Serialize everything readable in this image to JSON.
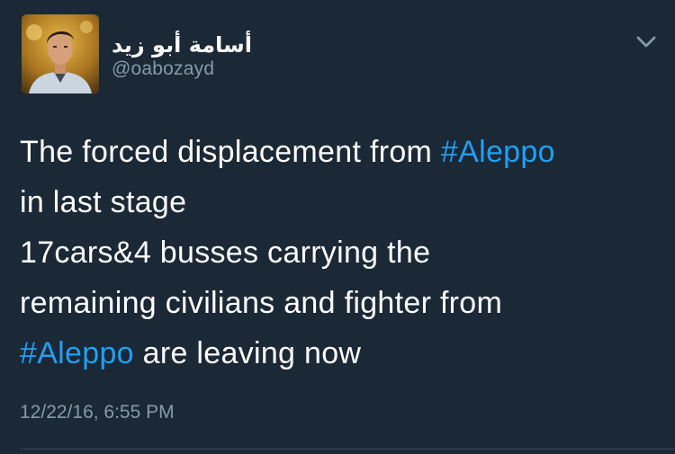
{
  "author": {
    "name": "أسامة أبو زيد",
    "handle": "@oabozayd",
    "avatar_icon": "profile-photo"
  },
  "tweet": {
    "lines": [
      [
        {
          "text": "The forced displacement from ",
          "hashtag": false
        },
        {
          "text": "#Aleppo",
          "hashtag": true
        }
      ],
      [
        {
          "text": "in last stage",
          "hashtag": false
        }
      ],
      [
        {
          "text": "17cars&4 busses carrying the",
          "hashtag": false
        }
      ],
      [
        {
          "text": "remaining civilians and fighter from",
          "hashtag": false
        }
      ],
      [
        {
          "text": "#Aleppo",
          "hashtag": true
        },
        {
          "text": " are leaving now",
          "hashtag": false
        }
      ]
    ],
    "timestamp": "12/22/16, 6:55 PM"
  },
  "menu": {
    "icon": "chevron-down-icon"
  },
  "colors": {
    "background": "#1b2836",
    "text": "#ffffff",
    "secondary_text": "#8899a6",
    "hashtag": "#1da1f2",
    "divider": "#38444d"
  }
}
